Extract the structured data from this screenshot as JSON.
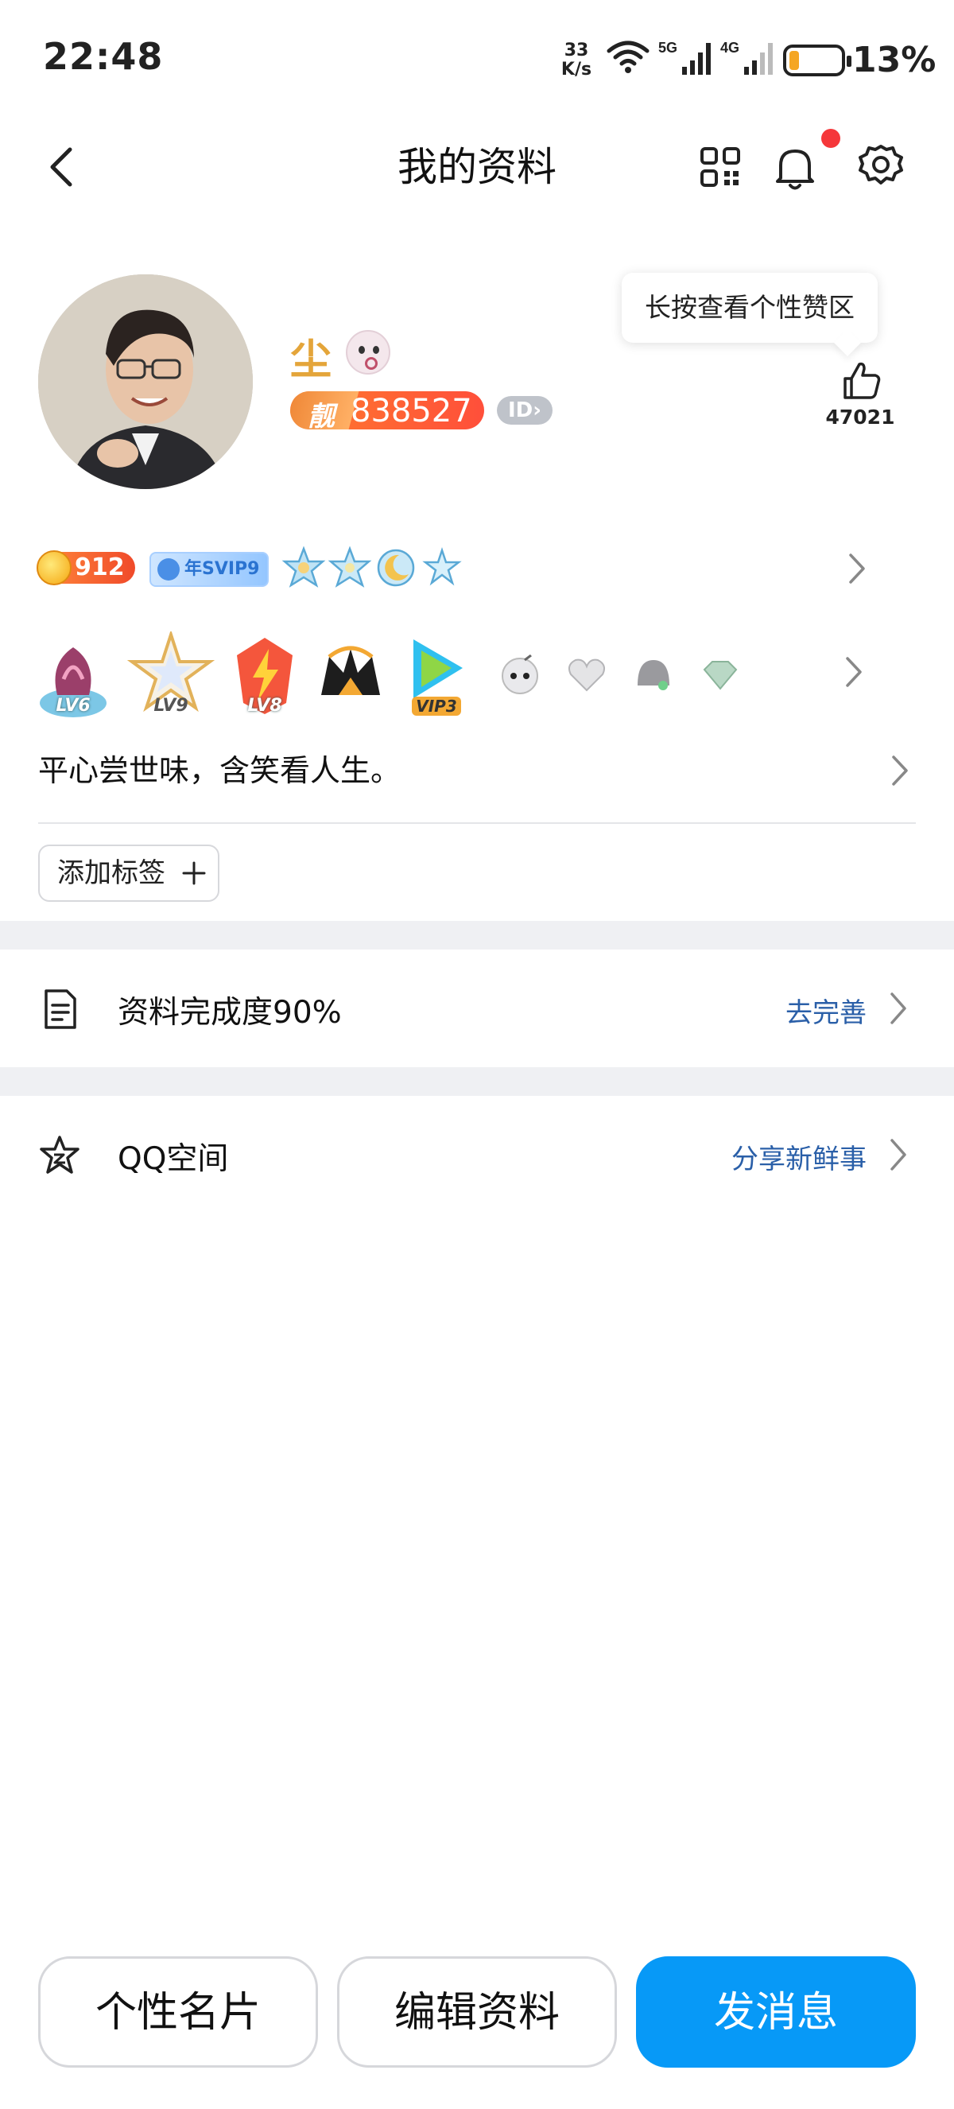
{
  "status_bar": {
    "time": "22:48",
    "net_speed_value": "33",
    "net_speed_unit": "K/s",
    "signal_1_label": "5G",
    "signal_2_label": "4G",
    "battery_percent": "13%",
    "battery_level": 0.13
  },
  "nav": {
    "title": "我的资料"
  },
  "profile": {
    "nickname": "尘",
    "pretty_tag": "靓",
    "qq_number": "838527",
    "id_chip": "ID›",
    "tooltip": "长按查看个性赞区",
    "like_count": "47021"
  },
  "badges_row1": {
    "coin_value": "912",
    "svip_label": "年SVIP9"
  },
  "badges_row2": {
    "lv_badges": [
      "LV6",
      "LV9",
      "LV8"
    ],
    "vip_label": "VIP3"
  },
  "signature": "平心尝世味，含笑看人生。",
  "add_tag_label": "添加标签",
  "completion_row": {
    "label": "资料完成度90%",
    "action": "去完善"
  },
  "qzone_row": {
    "label": "QQ空间",
    "action": "分享新鲜事"
  },
  "bottom_bar": {
    "card_label": "个性名片",
    "edit_label": "编辑资料",
    "message_label": "发消息"
  },
  "colors": {
    "accent_blue": "#0799f7",
    "link_blue": "#2a5fa8",
    "nickname_gold": "#e4a53a",
    "notification_red": "#f5373a"
  }
}
